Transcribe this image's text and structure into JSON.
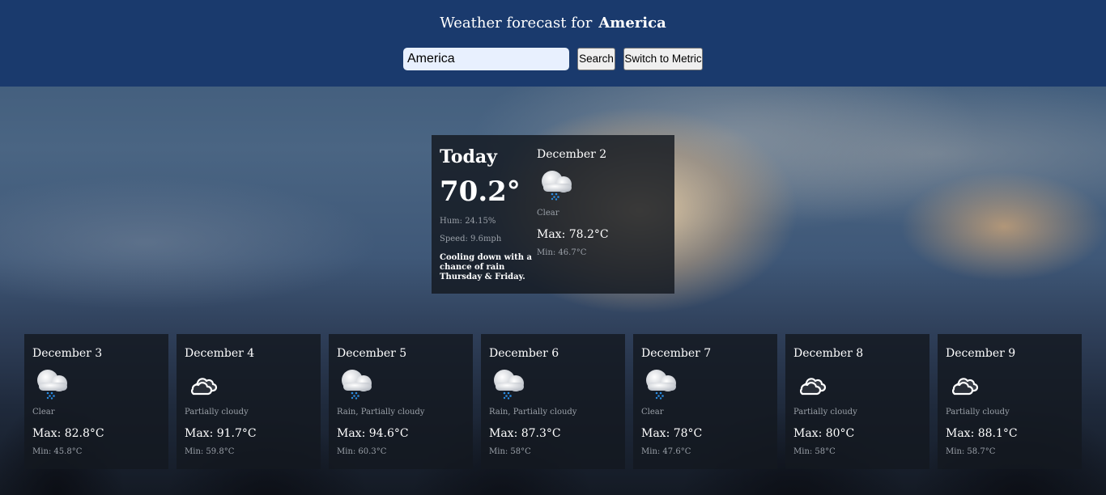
{
  "header": {
    "title_prefix": "Weather forecast for",
    "location": "America",
    "search_value": "America",
    "search_label": "Search",
    "units_toggle_label": "Switch to Metric",
    "background_color": "#1a3a6d"
  },
  "today": {
    "heading": "Today",
    "temperature": "70.2°",
    "humidity": "Hum: 24.15%",
    "wind_speed": "Speed: 9.6mph",
    "description": "Cooling down with a chance of rain Thursday & Friday.",
    "forecast": {
      "date": "December 2",
      "icon": "rain-cloud-icon",
      "condition": "Clear",
      "max": "Max: 78.2°C",
      "min": "Min: 46.7°C"
    }
  },
  "days": [
    {
      "date": "December 3",
      "icon": "rain-cloud-icon",
      "condition": "Clear",
      "max": "Max: 82.8°C",
      "min": "Min: 45.8°C"
    },
    {
      "date": "December 4",
      "icon": "partly-cloudy-icon",
      "condition": "Partially cloudy",
      "max": "Max: 91.7°C",
      "min": "Min: 59.8°C"
    },
    {
      "date": "December 5",
      "icon": "rain-cloud-icon",
      "condition": "Rain, Partially cloudy",
      "max": "Max: 94.6°C",
      "min": "Min: 60.3°C"
    },
    {
      "date": "December 6",
      "icon": "rain-cloud-icon",
      "condition": "Rain, Partially cloudy",
      "max": "Max: 87.3°C",
      "min": "Min: 58°C"
    },
    {
      "date": "December 7",
      "icon": "rain-cloud-icon",
      "condition": "Clear",
      "max": "Max: 78°C",
      "min": "Min: 47.6°C"
    },
    {
      "date": "December 8",
      "icon": "partly-cloudy-icon",
      "condition": "Partially cloudy",
      "max": "Max: 80°C",
      "min": "Min: 58°C"
    },
    {
      "date": "December 9",
      "icon": "partly-cloudy-icon",
      "condition": "Partially cloudy",
      "max": "Max: 88.1°C",
      "min": "Min: 58.7°C"
    }
  ]
}
